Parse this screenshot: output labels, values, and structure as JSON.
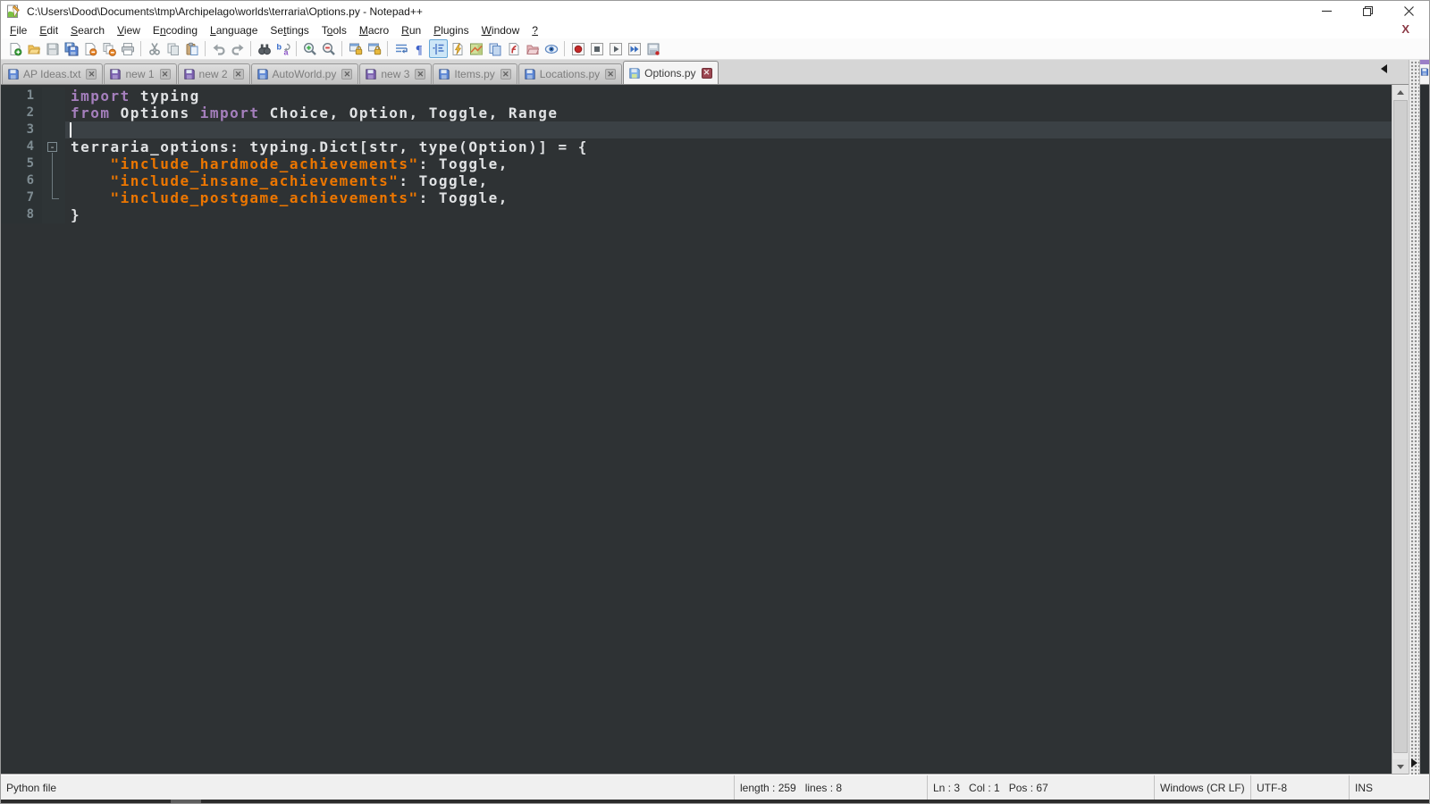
{
  "window": {
    "title": "C:\\Users\\Dood\\Documents\\tmp\\Archipelago\\worlds\\terraria\\Options.py - Notepad++",
    "controls": {
      "minimize": "minimize",
      "restore": "restore",
      "close": "close"
    }
  },
  "menu": {
    "items": [
      {
        "label": "File",
        "u": 0
      },
      {
        "label": "Edit",
        "u": 0
      },
      {
        "label": "Search",
        "u": 0
      },
      {
        "label": "View",
        "u": 0
      },
      {
        "label": "Encoding",
        "u": 1
      },
      {
        "label": "Language",
        "u": 0
      },
      {
        "label": "Settings",
        "u": 2
      },
      {
        "label": "Tools",
        "u": 1
      },
      {
        "label": "Macro",
        "u": 0
      },
      {
        "label": "Run",
        "u": 0
      },
      {
        "label": "Plugins",
        "u": 0
      },
      {
        "label": "Window",
        "u": 0
      },
      {
        "label": "?",
        "u": 0
      }
    ],
    "doc_close_x": "X"
  },
  "toolbar": {
    "active_icon": "indent-guide-icon",
    "groups": [
      [
        "new-file-icon",
        "open-file-icon",
        "save-icon",
        "save-all-icon",
        "close-file-icon",
        "close-all-icon",
        "print-icon"
      ],
      [
        "cut-icon",
        "copy-icon",
        "paste-icon"
      ],
      [
        "undo-icon",
        "redo-icon"
      ],
      [
        "find-icon",
        "replace-icon"
      ],
      [
        "zoom-in-icon",
        "zoom-out-icon"
      ],
      [
        "sync-vertical-scroll-icon",
        "sync-horizontal-scroll-icon"
      ],
      [
        "word-wrap-icon",
        "show-all-characters-icon",
        "indent-guide-icon",
        "user-defined-language-icon",
        "document-map-icon",
        "document-list-icon",
        "function-list-icon",
        "folder-as-workspace-icon",
        "monitoring-icon"
      ],
      [
        "macro-record-icon",
        "macro-stop-icon",
        "macro-play-icon",
        "macro-run-multiple-icon",
        "macro-save-icon"
      ]
    ]
  },
  "tabs": [
    {
      "label": "AP Ideas.txt",
      "icon": "floppy-saved",
      "active": false
    },
    {
      "label": "new 1",
      "icon": "floppy-new",
      "active": false
    },
    {
      "label": "new 2",
      "icon": "floppy-new",
      "active": false
    },
    {
      "label": "AutoWorld.py",
      "icon": "floppy-saved",
      "active": false
    },
    {
      "label": "new 3",
      "icon": "floppy-new",
      "active": false
    },
    {
      "label": "Items.py",
      "icon": "floppy-saved",
      "active": false
    },
    {
      "label": "Locations.py",
      "icon": "floppy-saved",
      "active": false
    },
    {
      "label": "Options.py",
      "icon": "floppy-active",
      "active": true
    }
  ],
  "editor": {
    "caret_line": 3,
    "lines": [
      {
        "num": "1",
        "fold": null,
        "tokens": [
          [
            "k",
            "import"
          ],
          [
            "d",
            " typing"
          ]
        ]
      },
      {
        "num": "2",
        "fold": null,
        "tokens": [
          [
            "k",
            "from"
          ],
          [
            "d",
            " Options "
          ],
          [
            "k",
            "import"
          ],
          [
            "d",
            " Choice, Option, Toggle, Range"
          ]
        ]
      },
      {
        "num": "3",
        "fold": null,
        "tokens": []
      },
      {
        "num": "4",
        "fold": "box",
        "tokens": [
          [
            "d",
            "terraria_options: typing.Dict[str, type(Option)] = {"
          ]
        ]
      },
      {
        "num": "5",
        "fold": "line",
        "tokens": [
          [
            "d",
            "    "
          ],
          [
            "s",
            "\"include_hardmode_achievements\""
          ],
          [
            "d",
            ": Toggle,"
          ]
        ]
      },
      {
        "num": "6",
        "fold": "line",
        "tokens": [
          [
            "d",
            "    "
          ],
          [
            "s",
            "\"include_insane_achievements\""
          ],
          [
            "d",
            ": Toggle,"
          ]
        ]
      },
      {
        "num": "7",
        "fold": "corner",
        "tokens": [
          [
            "d",
            "    "
          ],
          [
            "s",
            "\"include_postgame_achievements\""
          ],
          [
            "d",
            ": Toggle,"
          ]
        ]
      },
      {
        "num": "8",
        "fold": null,
        "tokens": [
          [
            "d",
            "}"
          ]
        ]
      }
    ],
    "fold_box_glyph": "-"
  },
  "status": {
    "doc_type": "Python file",
    "length_lines": "length : 259   lines : 8",
    "cursor": "Ln : 3   Col : 1   Pos : 67",
    "eol": "Windows (CR LF)",
    "encoding": "UTF-8",
    "insert_mode": "INS"
  },
  "colors": {
    "editor_bg": "#2e3234",
    "caret_line_bg": "#3b4145",
    "keyword": "#a57fbd",
    "string": "#ec7600",
    "default_text": "#e0e2e4",
    "line_number": "#7e8c92",
    "active_tab_close_bg": "#9c4752",
    "toolbar_active_bg": "#cde6f7"
  }
}
